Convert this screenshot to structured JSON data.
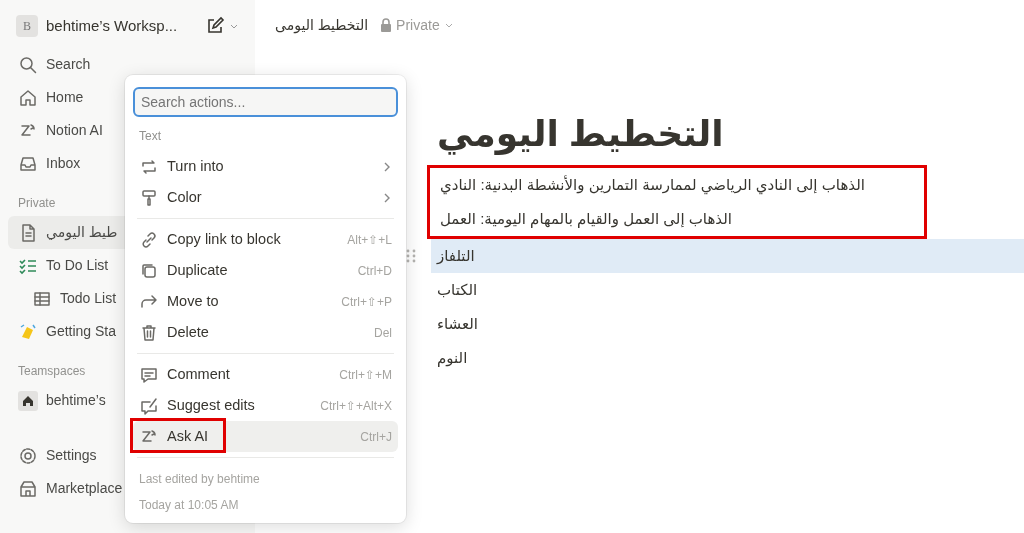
{
  "workspace": {
    "initial": "B",
    "name": "behtime’s Worksp..."
  },
  "nav": [
    {
      "label": "Search"
    },
    {
      "label": "Home"
    },
    {
      "label": "Notion AI"
    },
    {
      "label": "Inbox"
    }
  ],
  "sections": [
    {
      "title": "Private",
      "pages": [
        {
          "label": "طيط اليومي",
          "selected": true
        },
        {
          "label": "To Do List",
          "selected": false,
          "children": [
            {
              "label": "Todo List",
              "selected": false
            }
          ]
        },
        {
          "label": "Getting Sta",
          "selected": false
        }
      ]
    },
    {
      "title": "Teamspaces",
      "pages": [
        {
          "label": "behtime’s",
          "selected": false
        }
      ]
    }
  ],
  "bottom_nav": [
    {
      "label": "Settings"
    },
    {
      "label": "Marketplace"
    }
  ],
  "topbar": {
    "breadcrumb": "التخطيط اليومى",
    "privacy": "Private"
  },
  "page": {
    "title": "التخطيط اليومي",
    "blocks": [
      {
        "text": "الذهاب إلى النادي الرياضي لممارسة التمارين والأنشطة البدنية: النادي",
        "selected": false,
        "boxed": true
      },
      {
        "text": "الذهاب إلى العمل والقيام بالمهام اليومية: العمل",
        "selected": false,
        "boxed": true
      },
      {
        "text": "التلفاز",
        "selected": true,
        "boxed": false
      },
      {
        "text": "الكتاب",
        "selected": false,
        "boxed": false
      },
      {
        "text": "العشاء",
        "selected": false,
        "boxed": false
      },
      {
        "text": "النوم",
        "selected": false,
        "boxed": false
      }
    ]
  },
  "menu": {
    "placeholder": "Search actions...",
    "section": "Text",
    "groups": [
      [
        {
          "label": "Turn into",
          "kind": "submenu",
          "hovered": false,
          "boxed": false
        },
        {
          "label": "Color",
          "kind": "submenu",
          "hovered": false,
          "boxed": false
        }
      ],
      [
        {
          "label": "Copy link to block",
          "kind": "action",
          "shortcut": "Alt+⇧+L",
          "hovered": false,
          "boxed": false
        },
        {
          "label": "Duplicate",
          "kind": "action",
          "shortcut": "Ctrl+D",
          "hovered": false,
          "boxed": false
        },
        {
          "label": "Move to",
          "kind": "action",
          "shortcut": "Ctrl+⇧+P",
          "hovered": false,
          "boxed": false
        },
        {
          "label": "Delete",
          "kind": "action",
          "shortcut": "Del",
          "hovered": false,
          "boxed": false
        }
      ],
      [
        {
          "label": "Comment",
          "kind": "action",
          "shortcut": "Ctrl+⇧+M",
          "hovered": false,
          "boxed": false
        },
        {
          "label": "Suggest edits",
          "kind": "action",
          "shortcut": "Ctrl+⇧+Alt+X",
          "hovered": false,
          "boxed": false
        },
        {
          "label": "Ask AI",
          "kind": "action",
          "shortcut": "Ctrl+J",
          "hovered": true,
          "boxed": true
        }
      ]
    ],
    "footer": [
      "Last edited by behtime",
      "Today at 10:05 AM"
    ]
  }
}
